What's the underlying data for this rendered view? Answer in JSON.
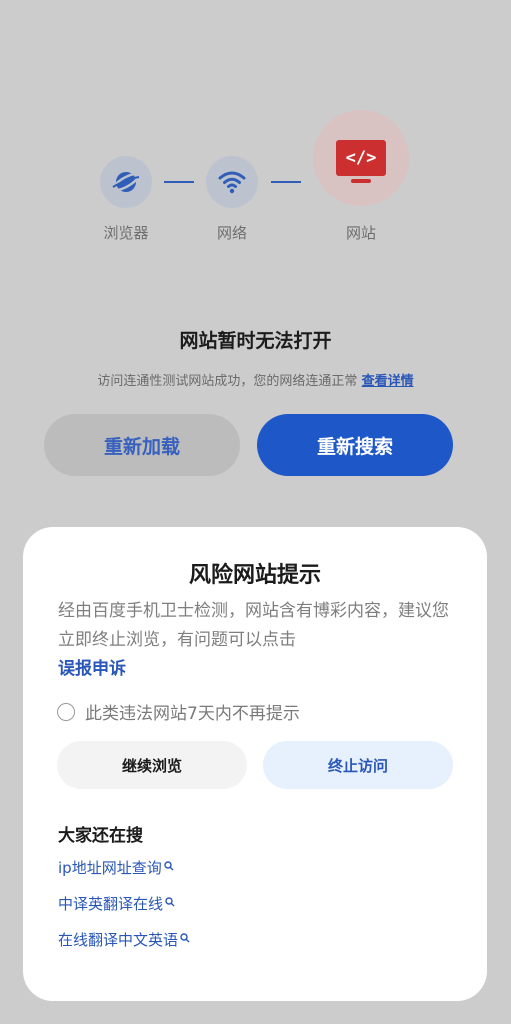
{
  "colors": {
    "accent": "#1e57c8",
    "link": "#2a57b7",
    "danger": "#cc2f2f",
    "overlay": "#cccccc"
  },
  "diagnostic": {
    "nodes": [
      {
        "label": "浏览器",
        "icon": "planet-icon"
      },
      {
        "label": "网络",
        "icon": "wifi-icon"
      },
      {
        "label": "网站",
        "icon": "code-monitor-icon",
        "icon_text": "</>"
      }
    ]
  },
  "error": {
    "title": "网站暂时无法打开",
    "desc": "访问连通性测试网站成功，您的网络连通正常",
    "details_link": "查看详情"
  },
  "actions": {
    "reload": "重新加载",
    "research": "重新搜索"
  },
  "risk_dialog": {
    "title": "风险网站提示",
    "message": "经由百度手机卫士检测，网站含有博彩内容，建议您立即终止浏览，有问题可以点击",
    "report_link": "误报申诉",
    "checkbox_label": "此类违法网站7天内不再提示",
    "continue_button": "继续浏览",
    "stop_button": "终止访问",
    "suggestions_title": "大家还在搜",
    "suggestions": [
      "ip地址网址查询",
      "中译英翻译在线",
      "在线翻译中文英语"
    ]
  }
}
